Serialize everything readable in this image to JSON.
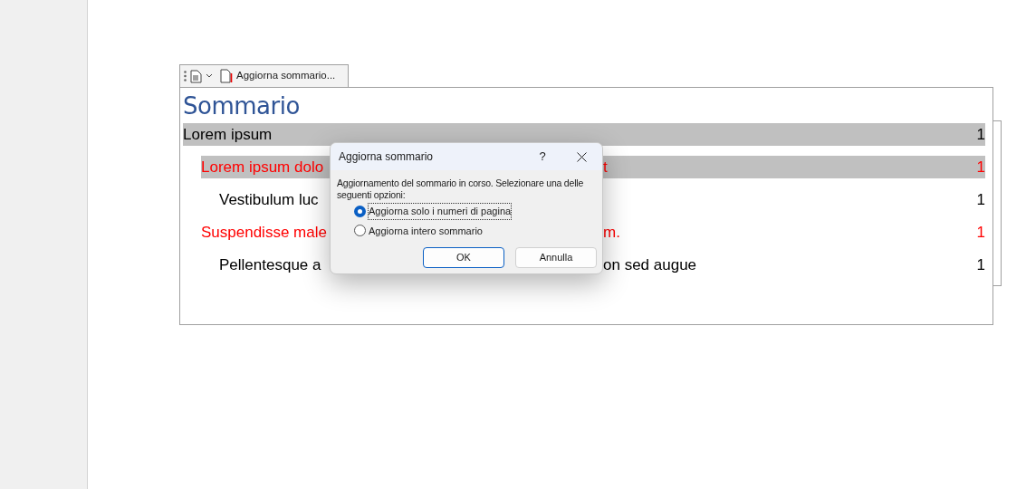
{
  "toc_toolbar": {
    "button_label": "Aggiorna sommario..."
  },
  "toc": {
    "title": "Sommario",
    "entries": [
      {
        "text_start": "Lorem ipsum",
        "page": "1",
        "color": "#000000",
        "highlighted": true,
        "children": [
          {
            "text_start": "Lorem ipsum dolo",
            "text_end": "t",
            "page": "1",
            "color": "#ff0000",
            "highlighted": true,
            "children": [
              {
                "text_start": "Vestibulum luc",
                "page": "1",
                "color": "#000000",
                "highlighted": false
              }
            ]
          },
          {
            "text_start": "Suspendisse male",
            "text_end": "m.",
            "page": "1",
            "color": "#ff0000",
            "highlighted": false,
            "children": [
              {
                "text_start": "Pellentesque a",
                "text_end": "on sed augue",
                "page": "1",
                "color": "#000000",
                "highlighted": false
              }
            ]
          }
        ]
      }
    ]
  },
  "dialog": {
    "title": "Aggiorna sommario",
    "help": "?",
    "message": "Aggiornamento del sommario in corso. Selezionare una delle seguenti opzioni:",
    "options": [
      {
        "label": "Aggiorna solo i numeri di pagina",
        "selected": true
      },
      {
        "label": "Aggiorna intero sommario",
        "selected": false
      }
    ],
    "buttons": [
      {
        "label": "OK",
        "default": true
      },
      {
        "label": "Annulla",
        "default": false
      }
    ]
  }
}
